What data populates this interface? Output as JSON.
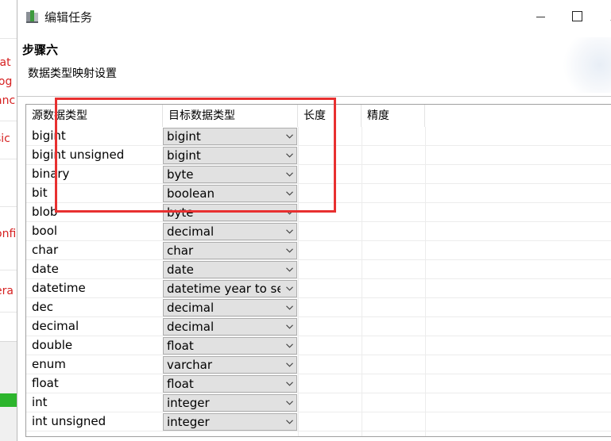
{
  "background": {
    "fragments": [
      "tat",
      "log",
      "anc",
      "sic",
      "onfi",
      "era"
    ]
  },
  "window": {
    "title": "编辑任务",
    "icon": "app-window-icon",
    "minimize_icon": "minimize-icon",
    "maximize_icon": "maximize-icon",
    "close_label": "X"
  },
  "header": {
    "step_title": "步骤六",
    "subtitle": "数据类型映射设置"
  },
  "table": {
    "columns": [
      "源数据类型",
      "目标数据类型",
      "长度",
      "精度"
    ],
    "rows": [
      {
        "source": "bigint",
        "target": "bigint"
      },
      {
        "source": "bigint unsigned",
        "target": "bigint"
      },
      {
        "source": "binary",
        "target": "byte"
      },
      {
        "source": "bit",
        "target": "boolean"
      },
      {
        "source": "blob",
        "target": "byte"
      },
      {
        "source": "bool",
        "target": "decimal"
      },
      {
        "source": "char",
        "target": "char"
      },
      {
        "source": "date",
        "target": "date"
      },
      {
        "source": "datetime",
        "target": "datetime year to se"
      },
      {
        "source": "dec",
        "target": "decimal"
      },
      {
        "source": "decimal",
        "target": "decimal"
      },
      {
        "source": "double",
        "target": "float"
      },
      {
        "source": "enum",
        "target": "varchar"
      },
      {
        "source": "float",
        "target": "float"
      },
      {
        "source": "int",
        "target": "integer"
      },
      {
        "source": "int unsigned",
        "target": "integer"
      }
    ]
  },
  "colors": {
    "annotation": "#e83030",
    "background_text": "#d62020",
    "select_background": "#e1e1e1"
  }
}
